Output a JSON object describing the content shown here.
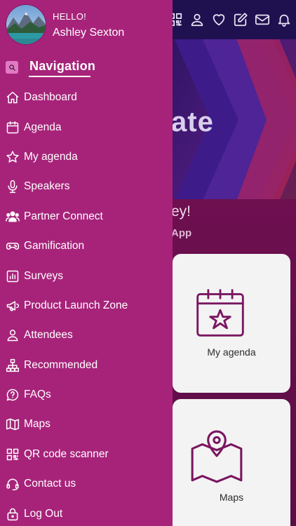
{
  "profile": {
    "greeting": "HELLO!",
    "name": "Ashley Sexton"
  },
  "navigation": {
    "title": "Navigation"
  },
  "menu": [
    {
      "label": "Dashboard",
      "icon": "home-icon"
    },
    {
      "label": "Agenda",
      "icon": "calendar-icon"
    },
    {
      "label": "My agenda",
      "icon": "star-icon"
    },
    {
      "label": "Speakers",
      "icon": "microphone-icon"
    },
    {
      "label": "Partner Connect",
      "icon": "users-icon"
    },
    {
      "label": "Gamification",
      "icon": "gamepad-icon"
    },
    {
      "label": "Surveys",
      "icon": "bar-chart-icon"
    },
    {
      "label": "Product Launch Zone",
      "icon": "megaphone-icon"
    },
    {
      "label": "Attendees",
      "icon": "person-icon"
    },
    {
      "label": "Recommended",
      "icon": "sitemap-icon"
    },
    {
      "label": "FAQs",
      "icon": "question-bubble-icon"
    },
    {
      "label": "Maps",
      "icon": "map-icon"
    },
    {
      "label": "QR code scanner",
      "icon": "qr-code-icon"
    },
    {
      "label": "Contact us",
      "icon": "headset-icon"
    },
    {
      "label": "Log Out",
      "icon": "lock-icon"
    }
  ],
  "background": {
    "banner_text": "ate",
    "greeting_partial": "ey!",
    "subtitle_partial": "App",
    "cards": [
      {
        "label": "My agenda",
        "icon": "calendar-star-icon"
      },
      {
        "label": "Maps",
        "icon": "map-pin-icon"
      }
    ]
  },
  "colors": {
    "drawer": "#a7237a",
    "topbar": "#1f1150",
    "accent": "#7a1660"
  }
}
